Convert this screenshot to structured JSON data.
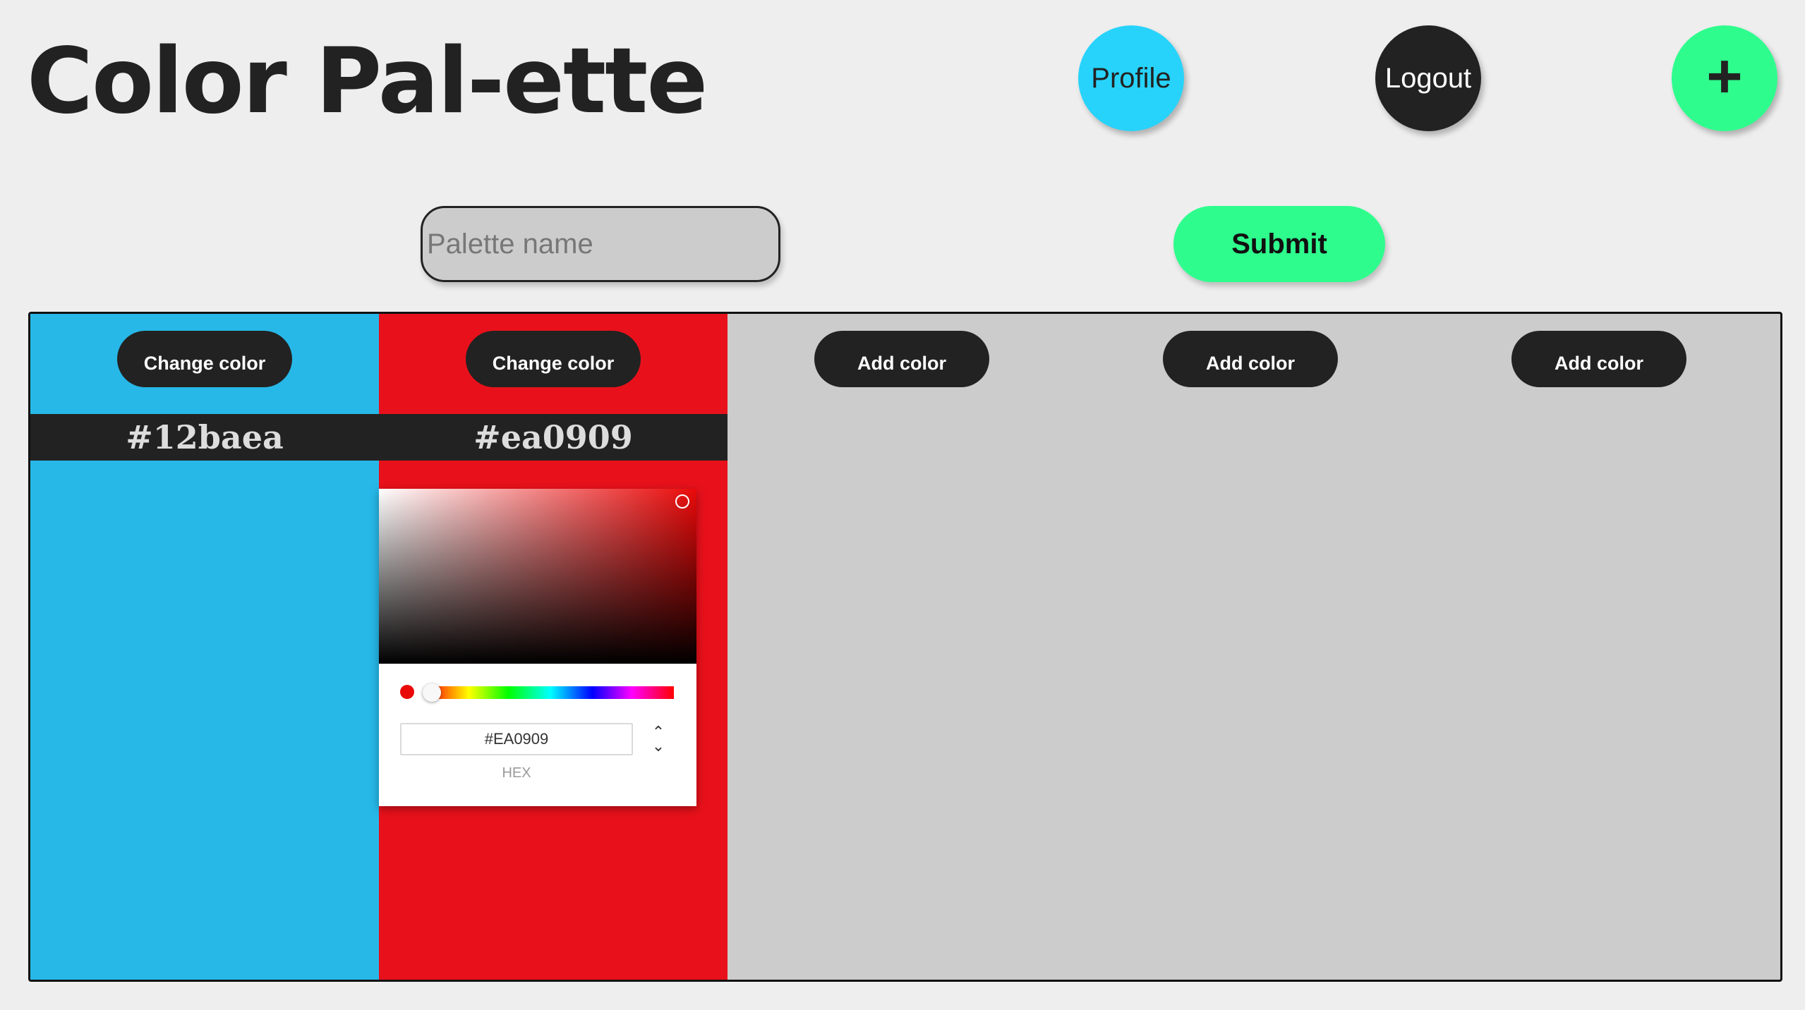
{
  "header": {
    "title": "Color Pal-ette",
    "profile_label": "Profile",
    "logout_label": "Logout",
    "add_label": "+"
  },
  "form": {
    "palette_name_placeholder": "Palette name",
    "palette_name_value": "",
    "submit_label": "Submit"
  },
  "swatches": [
    {
      "button_label": "Change color",
      "hex": "#12baea",
      "color": "#27b8e8"
    },
    {
      "button_label": "Change color",
      "hex": "#ea0909",
      "color": "#e8111b"
    },
    {
      "button_label": "Add color",
      "color": "#cccccc"
    },
    {
      "button_label": "Add color",
      "color": "#cccccc"
    },
    {
      "button_label": "Add color",
      "color": "#cccccc"
    }
  ],
  "picker": {
    "hex_value": "#EA0909",
    "mode_label": "HEX",
    "selected_color": "#ea0909",
    "hue_position": 0.0,
    "saturation": 0.94,
    "brightness": 0.92
  },
  "colors": {
    "background": "#eeeeee",
    "profile": "#27d3fb",
    "dark": "#222222",
    "accent_green": "#2efd8d",
    "empty_swatch": "#cccccc"
  }
}
